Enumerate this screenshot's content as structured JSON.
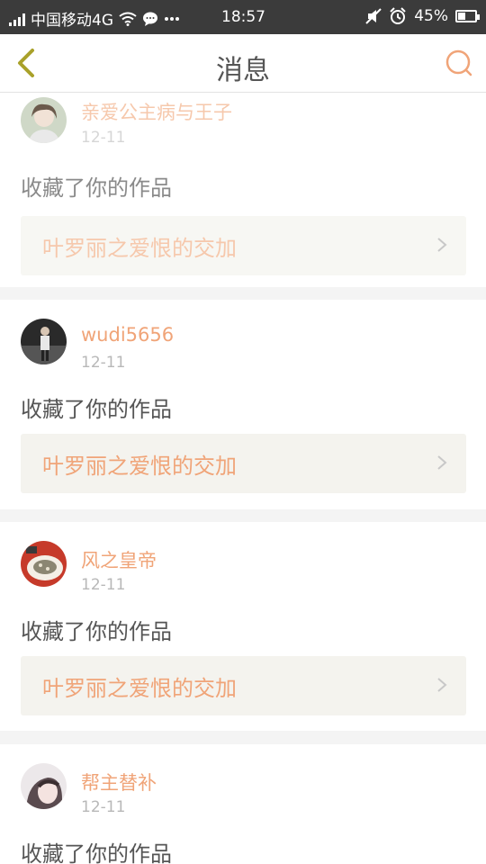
{
  "status_bar": {
    "carrier": "中国移动4G",
    "time": "18:57",
    "battery": "45%",
    "battery_level": 0.45,
    "icons": [
      "signal-icon",
      "wifi-icon",
      "message-icon",
      "more-dots-icon",
      "mute-icon",
      "alarm-icon",
      "battery-icon"
    ]
  },
  "header": {
    "title": "消息",
    "back_icon": "chevron-left-icon",
    "search_icon": "search-icon",
    "accent_color": "#f0a478",
    "back_color": "#a9a12a"
  },
  "feed": {
    "items": [
      {
        "username": "亲爱公主病与王子",
        "date": "12-11",
        "action": "收藏了你的作品",
        "work_title": "叶罗丽之爱恨的交加"
      },
      {
        "username": "wudi5656",
        "date": "12-11",
        "action": "收藏了你的作品",
        "work_title": "叶罗丽之爱恨的交加"
      },
      {
        "username": "风之皇帝",
        "date": "12-11",
        "action": "收藏了你的作品",
        "work_title": "叶罗丽之爱恨的交加"
      },
      {
        "username": "帮主替补",
        "date": "12-11",
        "action": "收藏了你的作品"
      }
    ]
  }
}
